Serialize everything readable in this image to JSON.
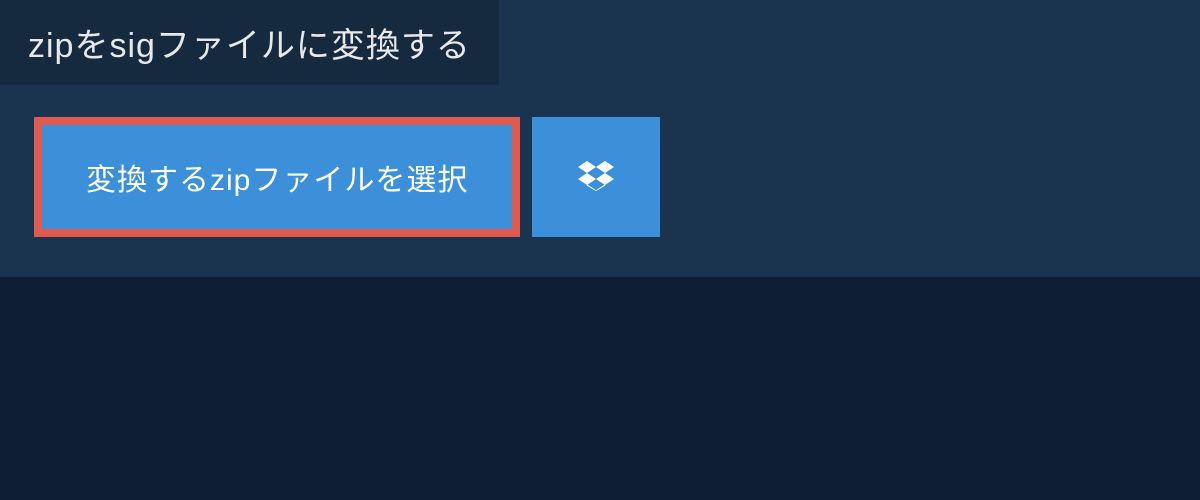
{
  "heading": "zipをsigファイルに変換する",
  "buttons": {
    "select_file_label": "変換するzipファイルを選択"
  },
  "colors": {
    "background": "#0f1f33",
    "panel": "#1a3450",
    "heading_bg": "#15293f",
    "button_bg": "#3c8fd9",
    "highlight_border": "#e05a4f",
    "text_light": "#e8e8e8",
    "text_white": "#ffffff"
  }
}
